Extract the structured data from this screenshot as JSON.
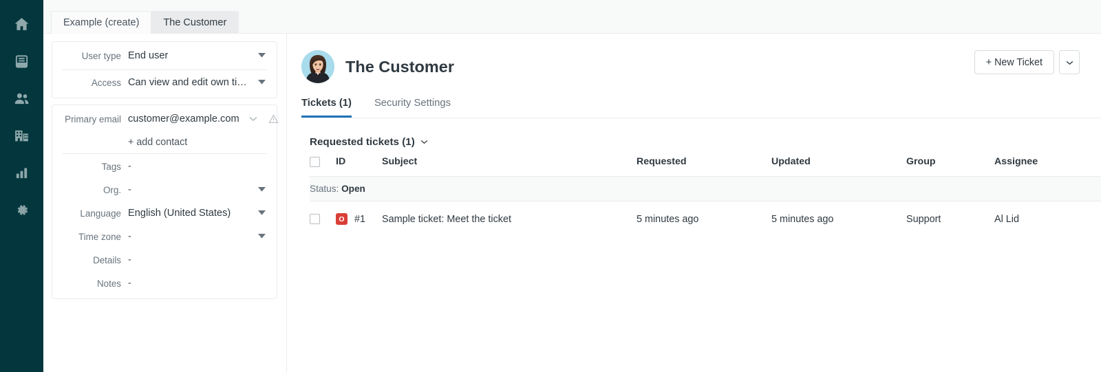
{
  "sidebar": {
    "items": [
      {
        "name": "home",
        "icon": "home-icon",
        "label": "Home"
      },
      {
        "name": "views",
        "icon": "tickets-stack-icon",
        "label": "Views"
      },
      {
        "name": "customers",
        "icon": "people-icon",
        "label": "Customers"
      },
      {
        "name": "organizations",
        "icon": "building-icon",
        "label": "Organizations"
      },
      {
        "name": "reporting",
        "icon": "bar-chart-icon",
        "label": "Reporting"
      },
      {
        "name": "settings",
        "icon": "gear-icon",
        "label": "Admin"
      }
    ],
    "background_color": "#03363d",
    "icon_color": "#8fa8ab"
  },
  "tabstrip": {
    "tabs": [
      {
        "label": "Example (create)",
        "active": false
      },
      {
        "label": "The Customer",
        "active": true
      }
    ]
  },
  "profile_panel": {
    "card1": {
      "user_type": {
        "label": "User type",
        "value": "End user"
      },
      "access": {
        "label": "Access",
        "value": "Can view and edit own tick..."
      }
    },
    "card2": {
      "primary_email": {
        "label": "Primary email",
        "value": "customer@example.com"
      },
      "add_contact": "+ add contact",
      "tags": {
        "label": "Tags",
        "value": "-"
      },
      "org": {
        "label": "Org.",
        "value": "-"
      },
      "language": {
        "label": "Language",
        "value": "English (United States)"
      },
      "time_zone": {
        "label": "Time zone",
        "value": "-"
      },
      "details": {
        "label": "Details",
        "value": "-"
      },
      "notes": {
        "label": "Notes",
        "value": "-"
      }
    }
  },
  "main": {
    "customer_name": "The Customer",
    "new_ticket_button": "+ New Ticket",
    "tabs": [
      {
        "label": "Tickets (1)",
        "active": true
      },
      {
        "label": "Security Settings",
        "active": false
      }
    ],
    "section_title": "Requested tickets (1)",
    "table": {
      "headers": [
        "",
        "ID",
        "Subject",
        "Requested",
        "Updated",
        "Group",
        "Assignee"
      ],
      "status_group": {
        "prefix": "Status:",
        "value": "Open"
      },
      "rows": [
        {
          "badge": "O",
          "badge_color": "#d93f36",
          "id": "#1",
          "subject": "Sample ticket: Meet the ticket",
          "requested": "5 minutes ago",
          "updated": "5 minutes ago",
          "group": "Support",
          "assignee": "Al Lid"
        }
      ]
    }
  },
  "colors": {
    "accent_blue": "#1f73b7",
    "text_primary": "#2f3941",
    "text_secondary": "#68737d",
    "border": "#e9ebed",
    "sidebar": "#03363d",
    "status_open": "#d93f36"
  }
}
